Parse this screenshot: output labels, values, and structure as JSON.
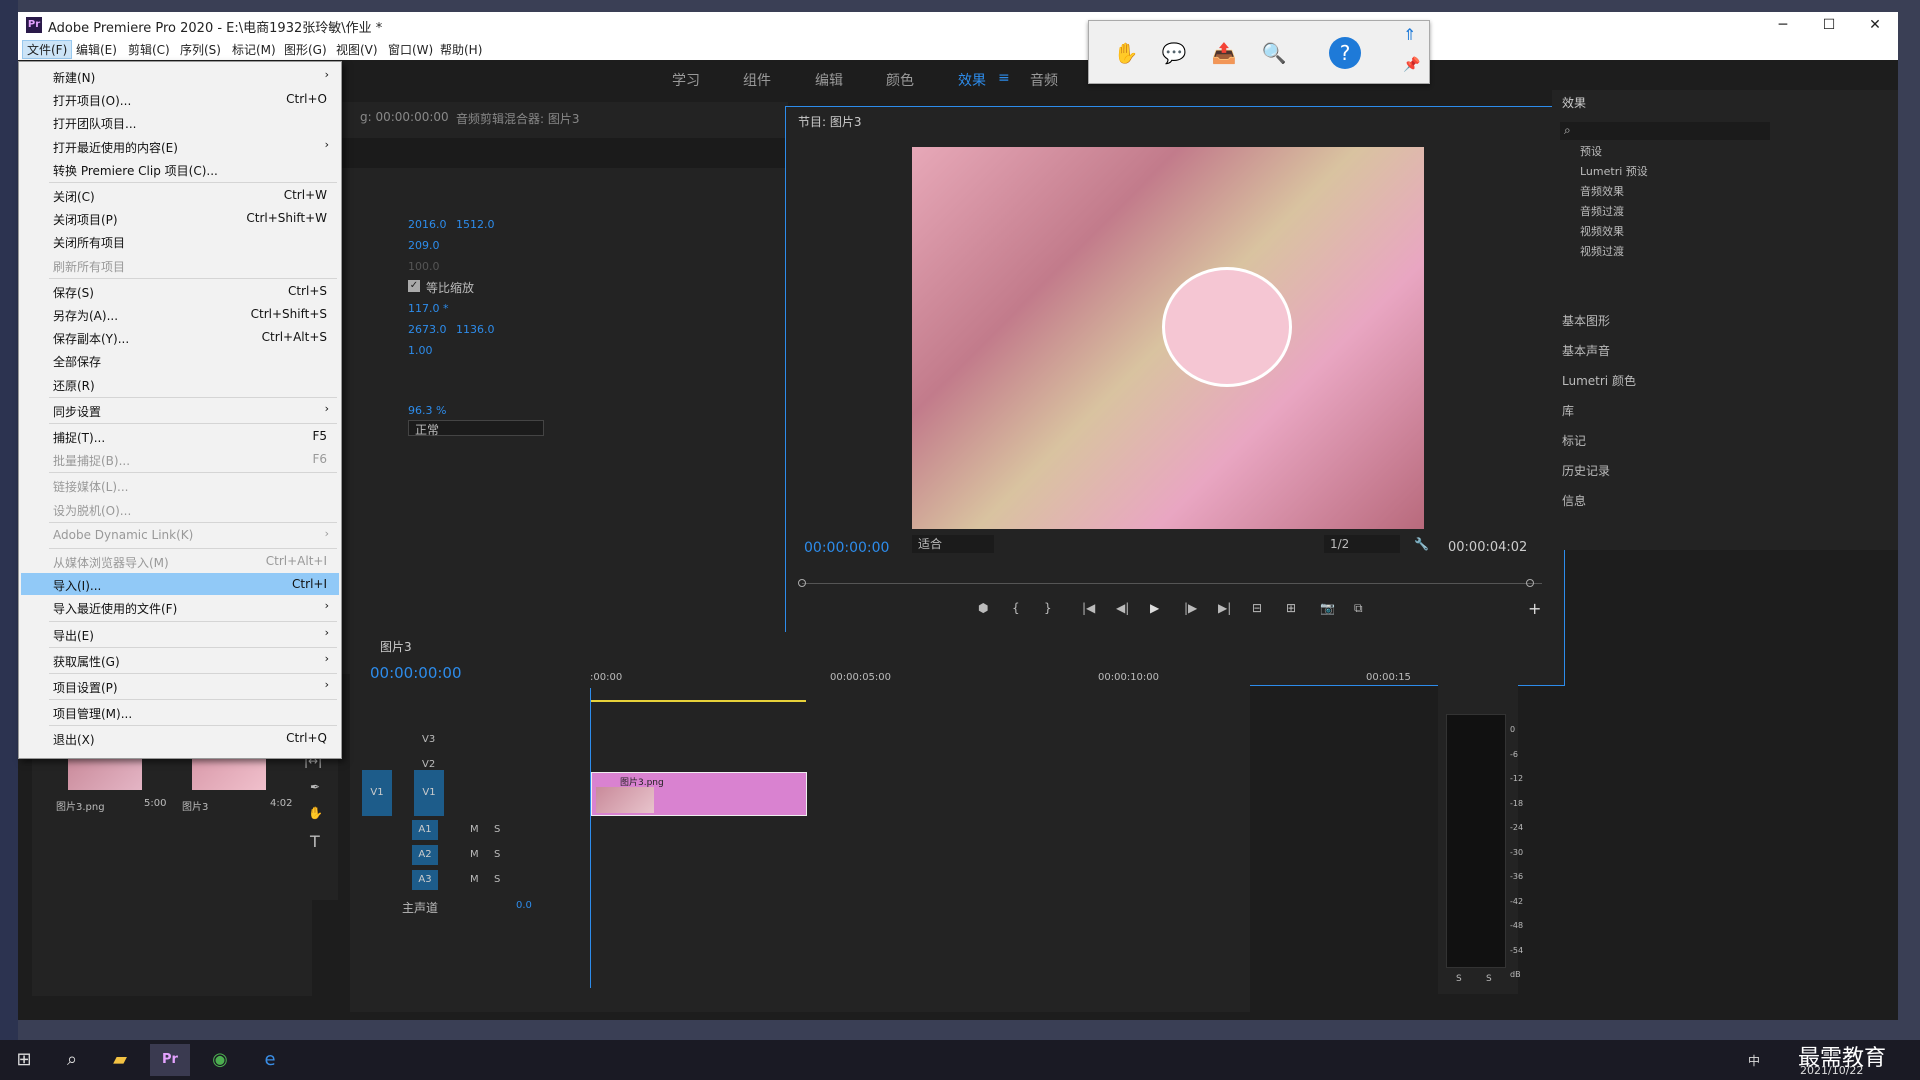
{
  "window": {
    "title": "Adobe Premiere Pro 2020 - E:\\电商1932张玲敏\\作业 *",
    "logo": "Pr",
    "controls": {
      "min": "─",
      "max": "☐",
      "close": "✕"
    }
  },
  "menubar": [
    "文件(F)",
    "编辑(E)",
    "剪辑(C)",
    "序列(S)",
    "标记(M)",
    "图形(G)",
    "视图(V)",
    "窗口(W)",
    "帮助(H)"
  ],
  "workspaces": [
    "学习",
    "组件",
    "编辑",
    "颜色",
    "效果",
    "音频"
  ],
  "workspace_active": "效果",
  "workspace_menu_icon": "≡",
  "file_menu": [
    {
      "label": "新建(N)",
      "shortcut": "",
      "arrow": true,
      "disabled": false
    },
    {
      "label": "打开项目(O)...",
      "shortcut": "Ctrl+O"
    },
    {
      "label": "打开团队项目..."
    },
    {
      "label": "打开最近使用的内容(E)",
      "arrow": true
    },
    {
      "label": "转换 Premiere Clip 项目(C)..."
    },
    {
      "label": "关闭(C)",
      "shortcut": "Ctrl+W"
    },
    {
      "label": "关闭项目(P)",
      "shortcut": "Ctrl+Shift+W"
    },
    {
      "label": "关闭所有项目"
    },
    {
      "label": "刷新所有项目",
      "disabled": true
    },
    {
      "label": "保存(S)",
      "shortcut": "Ctrl+S"
    },
    {
      "label": "另存为(A)...",
      "shortcut": "Ctrl+Shift+S"
    },
    {
      "label": "保存副本(Y)...",
      "shortcut": "Ctrl+Alt+S"
    },
    {
      "label": "全部保存"
    },
    {
      "label": "还原(R)"
    },
    {
      "label": "同步设置",
      "arrow": true
    },
    {
      "label": "捕捉(T)...",
      "shortcut": "F5"
    },
    {
      "label": "批量捕捉(B)...",
      "shortcut": "F6",
      "disabled": true
    },
    {
      "label": "链接媒体(L)...",
      "disabled": true
    },
    {
      "label": "设为脱机(O)...",
      "disabled": true
    },
    {
      "label": "Adobe Dynamic Link(K)",
      "arrow": true,
      "disabled": true
    },
    {
      "label": "从媒体浏览器导入(M)",
      "shortcut": "Ctrl+Alt+I",
      "disabled": true
    },
    {
      "label": "导入(I)...",
      "shortcut": "Ctrl+I",
      "highlight": true
    },
    {
      "label": "导入最近使用的文件(F)",
      "arrow": true
    },
    {
      "label": "导出(E)",
      "arrow": true
    },
    {
      "label": "获取属性(G)",
      "arrow": true
    },
    {
      "label": "项目设置(P)",
      "arrow": true
    },
    {
      "label": "项目管理(M)..."
    },
    {
      "label": "退出(X)",
      "shortcut": "Ctrl+Q"
    }
  ],
  "effect_controls": {
    "tab_timecode": "g: 00:00:00:00",
    "mixer_tab": "音频剪辑混合器: 图片3",
    "values": [
      "2016.0",
      "1512.0",
      "209.0",
      "100.0",
      "117.0 *",
      "2673.0",
      "1136.0",
      "1.00",
      "96.3 %"
    ],
    "checkbox_label": "等比缩放",
    "blend_mode": "正常"
  },
  "program": {
    "title": "节目: 图片3",
    "timecode": "00:00:00:00",
    "fit": "适合",
    "resolution": "1/2",
    "duration": "00:00:04:02"
  },
  "program_controls": [
    "⬢",
    "{",
    "}",
    "|◀",
    "◀|",
    "▶",
    "|▶",
    "▶|",
    "⊟",
    "⊞",
    "📷",
    "⧉",
    "+"
  ],
  "effects_panel": {
    "title": "效果",
    "search_icon": "⌕",
    "folders": [
      "预设",
      "Lumetri 预设",
      "音频效果",
      "音频过渡",
      "视频效果",
      "视频过渡"
    ],
    "sections": [
      "基本图形",
      "基本声音",
      "Lumetri 颜色",
      "库",
      "标记",
      "历史记录",
      "信息"
    ]
  },
  "timeline": {
    "tab": "图片3",
    "timecode": "00:00:00:00",
    "ruler": [
      ":00:00",
      "00:00:05:00",
      "00:00:10:00",
      "00:00:15"
    ],
    "video_tracks": [
      "V3",
      "V2",
      "V1"
    ],
    "source_patch": "V1",
    "audio_tracks": [
      "A1",
      "A2",
      "A3"
    ],
    "audio_buttons": [
      "M",
      "S"
    ],
    "master": "主声道",
    "master_value": "0.0",
    "clip_label": "图片3.png"
  },
  "project": {
    "items": [
      {
        "name": "图片3.png",
        "duration": "5:00"
      },
      {
        "name": "图片3",
        "duration": "4:02"
      }
    ]
  },
  "meter": {
    "scale": [
      "0",
      "-6",
      "-12",
      "-18",
      "-24",
      "-30",
      "-36",
      "-42",
      "-48",
      "-54",
      "dB"
    ],
    "solo": [
      "S",
      "S"
    ]
  },
  "toolbar_icons": [
    "✋",
    "💬",
    "📤",
    "🔍",
    "?",
    "⇑",
    "📌"
  ],
  "tools": [
    "|↔|",
    "✒",
    "✋",
    "T"
  ],
  "taskbar": {
    "time": "",
    "date": "2021/10/22",
    "ime": "中",
    "watermark": "最需教育"
  }
}
